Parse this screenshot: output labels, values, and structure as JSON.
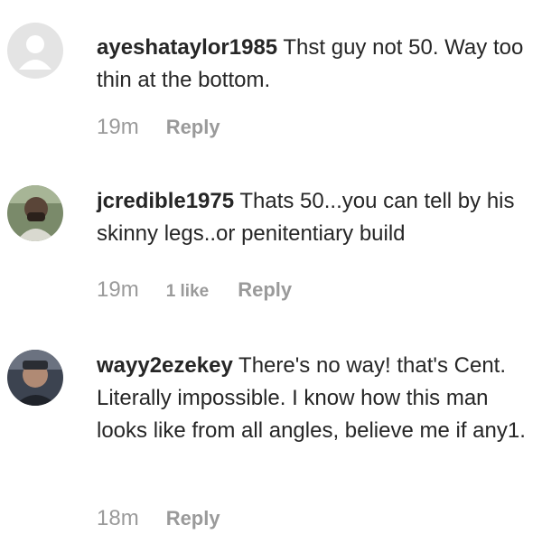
{
  "comments": [
    {
      "username": "ayeshataylor1985",
      "text": "Thst guy not 50. Way too thin at the bottom.",
      "time": "19m",
      "likes": "",
      "reply_label": "Reply",
      "avatar": "default-avatar-icon"
    },
    {
      "username": "jcredible1975",
      "text": "Thats 50...you can tell by his skinny legs..or penitentiary build",
      "time": "19m",
      "likes": "1 like",
      "reply_label": "Reply",
      "avatar": "user-photo"
    },
    {
      "username": "wayy2ezekey",
      "text": "There's no way! that's Cent. Literally impossible. I know how this man looks like from all angles, believe me if any1.",
      "time": "18m",
      "likes": "",
      "reply_label": "Reply",
      "avatar": "user-photo"
    }
  ],
  "colors": {
    "text": "#262626",
    "meta": "#9a9a9a",
    "default_avatar_bg": "#dbdbdb"
  }
}
